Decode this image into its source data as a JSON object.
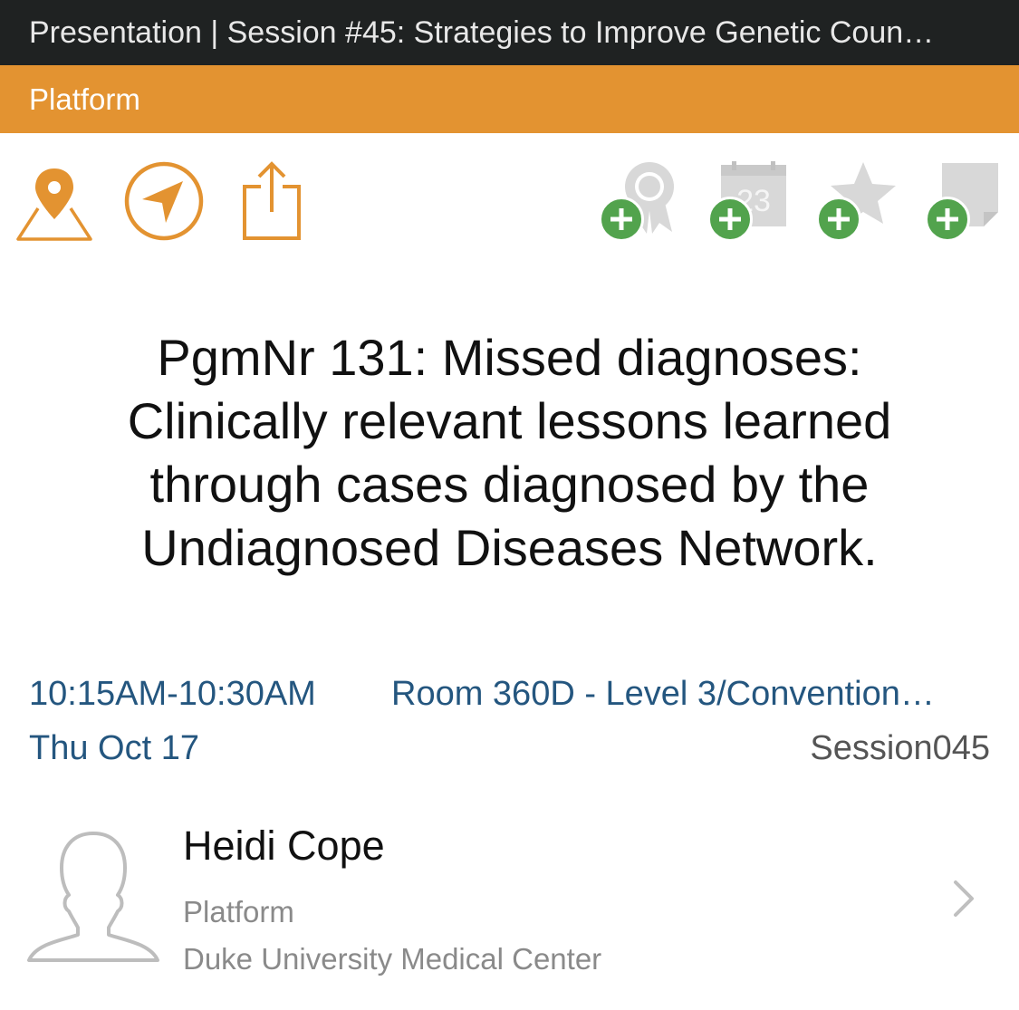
{
  "header": {
    "title": "Presentation | Session #45: Strategies to Improve Genetic Coun…",
    "category": "Platform"
  },
  "actions": {
    "left": [
      "map-pin-icon",
      "navigate-icon",
      "share-icon"
    ],
    "right": [
      {
        "icon": "ribbon-award-icon",
        "badge": "add-badge"
      },
      {
        "icon": "calendar-icon",
        "badge": "add-badge",
        "calendar_day": "23"
      },
      {
        "icon": "star-icon",
        "badge": "add-badge"
      },
      {
        "icon": "note-icon",
        "badge": "add-badge"
      }
    ]
  },
  "presentation": {
    "title": "PgmNr 131: Missed diagnoses: Clinically relevant lessons learned through cases diagnosed by the Undiagnosed Diseases Network."
  },
  "details": {
    "time": "10:15AM-10:30AM",
    "date": "Thu Oct 17",
    "room": "Room 360D - Level 3/Convention…",
    "session": "Session045"
  },
  "speaker": {
    "name": "Heidi Cope",
    "role": "Platform",
    "institution": "Duke University Medical Center"
  },
  "colors": {
    "title_bar": "#1f2222",
    "accent_orange": "#e39331",
    "badge_green": "#52a34d",
    "link_blue": "#24567f"
  }
}
